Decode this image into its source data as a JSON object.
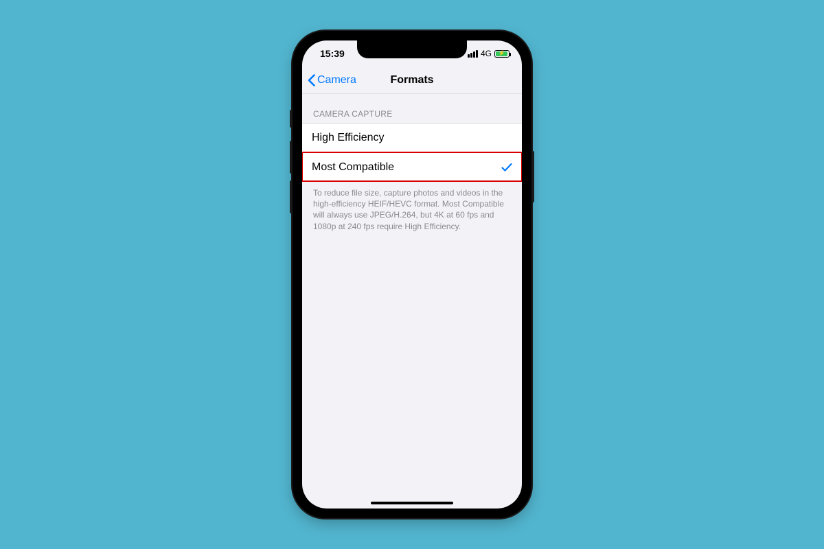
{
  "status": {
    "time": "15:39",
    "network_label": "4G"
  },
  "nav": {
    "back_label": "Camera",
    "title": "Formats"
  },
  "section": {
    "header": "CAMERA CAPTURE",
    "options": [
      {
        "label": "High Efficiency",
        "selected": false,
        "highlighted": false
      },
      {
        "label": "Most Compatible",
        "selected": true,
        "highlighted": true
      }
    ],
    "footer": "To reduce file size, capture photos and videos in the high-efficiency HEIF/HEVC format. Most Compatible will always use JPEG/H.264, but 4K at 60 fps and 1080p at 240 fps require High Efficiency."
  },
  "colors": {
    "background": "#52b5cf",
    "ios_blue": "#007aff",
    "highlight_red": "#d60000",
    "battery_green": "#34c759"
  }
}
